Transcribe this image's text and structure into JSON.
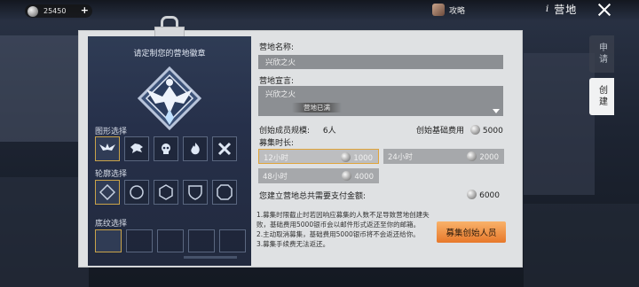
{
  "topbar": {
    "coins": "25450",
    "plus": "+",
    "guide_label": "攻略",
    "info_icon": "i",
    "title": "营地"
  },
  "side_tabs": [
    {
      "label": "申请",
      "active": false
    },
    {
      "label": "创建",
      "active": true
    }
  ],
  "badge": {
    "title": "请定制您的营地徽章",
    "shape_label": "图形选择",
    "outline_label": "轮廓选择",
    "pattern_label": "底纹选择"
  },
  "form": {
    "name_label": "营地名称:",
    "name_value": "兴欣之火",
    "declaration_label": "营地宣言:",
    "declaration_value": "兴欣之火",
    "status_tag": "营地已满",
    "founders_label": "创始成员规模:",
    "founders_value": "6人",
    "base_fee_label": "创始基础费用",
    "base_fee_value": "5000",
    "duration_label": "募集时长:",
    "durations": [
      {
        "label": "12小时",
        "cost": "1000",
        "selected": true
      },
      {
        "label": "24小时",
        "cost": "2000",
        "selected": false
      },
      {
        "label": "48小时",
        "cost": "4000",
        "selected": false
      }
    ],
    "total_label": "您建立营地总共需要支付金额:",
    "total_value": "6000",
    "notes": [
      "1.募集时限截止时若因响应募集的人数不足导致营地创建失败，基础费用5000银币会以邮件形式返还至你的邮箱。",
      "2.主动取消募集，基础费用5000银币将不会返还给你。",
      "3.募集手续费无法返还。"
    ],
    "recruit_button": "募集创始人员"
  },
  "colors": {
    "accent_orange": "#e7782a",
    "selected_border": "#e0a43a",
    "panel_navy": "#26304a"
  }
}
